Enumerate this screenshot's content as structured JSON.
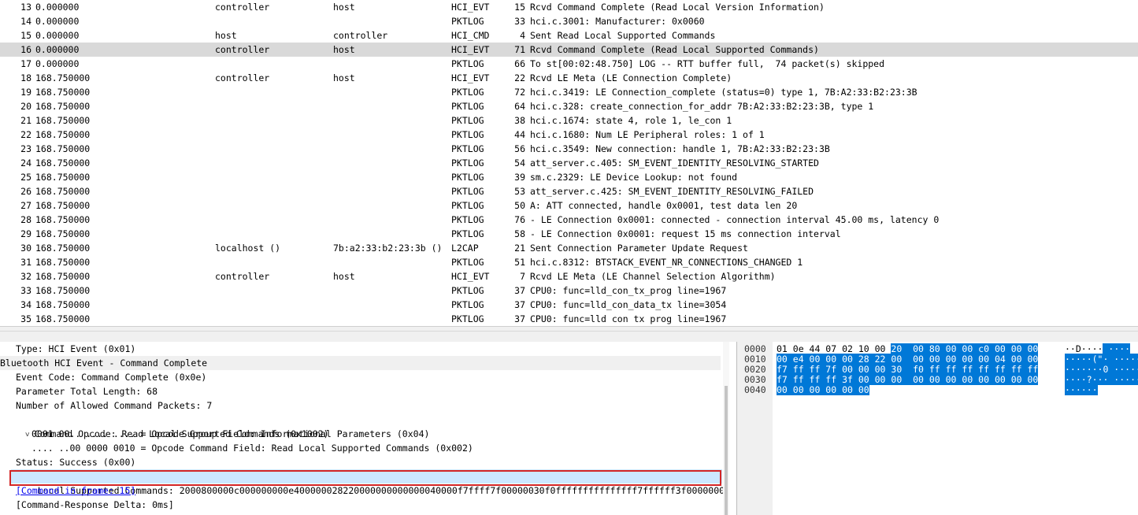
{
  "packets": [
    {
      "no": "13",
      "time": "0.000000",
      "src": "controller",
      "dst": "host",
      "proto": "HCI_EVT",
      "len": "15",
      "info": "Rcvd Command Complete (Read Local Version Information)"
    },
    {
      "no": "14",
      "time": "0.000000",
      "src": "",
      "dst": "",
      "proto": "PKTLOG",
      "len": "33",
      "info": "hci.c.3001: Manufacturer: 0x0060"
    },
    {
      "no": "15",
      "time": "0.000000",
      "src": "host",
      "dst": "controller",
      "proto": "HCI_CMD",
      "len": "4",
      "info": "Sent Read Local Supported Commands"
    },
    {
      "no": "16",
      "time": "0.000000",
      "src": "controller",
      "dst": "host",
      "proto": "HCI_EVT",
      "len": "71",
      "info": "Rcvd Command Complete (Read Local Supported Commands)"
    },
    {
      "no": "17",
      "time": "0.000000",
      "src": "",
      "dst": "",
      "proto": "PKTLOG",
      "len": "66",
      "info": "To st[00:02:48.750] LOG -- RTT buffer full,  74 packet(s) skipped"
    },
    {
      "no": "18",
      "time": "168.750000",
      "src": "controller",
      "dst": "host",
      "proto": "HCI_EVT",
      "len": "22",
      "info": "Rcvd LE Meta (LE Connection Complete)"
    },
    {
      "no": "19",
      "time": "168.750000",
      "src": "",
      "dst": "",
      "proto": "PKTLOG",
      "len": "72",
      "info": "hci.c.3419: LE Connection_complete (status=0) type 1, 7B:A2:33:B2:23:3B"
    },
    {
      "no": "20",
      "time": "168.750000",
      "src": "",
      "dst": "",
      "proto": "PKTLOG",
      "len": "64",
      "info": "hci.c.328: create_connection_for_addr 7B:A2:33:B2:23:3B, type 1"
    },
    {
      "no": "21",
      "time": "168.750000",
      "src": "",
      "dst": "",
      "proto": "PKTLOG",
      "len": "38",
      "info": "hci.c.1674: state 4, role 1, le_con 1"
    },
    {
      "no": "22",
      "time": "168.750000",
      "src": "",
      "dst": "",
      "proto": "PKTLOG",
      "len": "44",
      "info": "hci.c.1680: Num LE Peripheral roles: 1 of 1"
    },
    {
      "no": "23",
      "time": "168.750000",
      "src": "",
      "dst": "",
      "proto": "PKTLOG",
      "len": "56",
      "info": "hci.c.3549: New connection: handle 1, 7B:A2:33:B2:23:3B"
    },
    {
      "no": "24",
      "time": "168.750000",
      "src": "",
      "dst": "",
      "proto": "PKTLOG",
      "len": "54",
      "info": "att_server.c.405: SM_EVENT_IDENTITY_RESOLVING_STARTED"
    },
    {
      "no": "25",
      "time": "168.750000",
      "src": "",
      "dst": "",
      "proto": "PKTLOG",
      "len": "39",
      "info": "sm.c.2329: LE Device Lookup: not found"
    },
    {
      "no": "26",
      "time": "168.750000",
      "src": "",
      "dst": "",
      "proto": "PKTLOG",
      "len": "53",
      "info": "att_server.c.425: SM_EVENT_IDENTITY_RESOLVING_FAILED"
    },
    {
      "no": "27",
      "time": "168.750000",
      "src": "",
      "dst": "",
      "proto": "PKTLOG",
      "len": "50",
      "info": "A: ATT connected, handle 0x0001, test data len 20"
    },
    {
      "no": "28",
      "time": "168.750000",
      "src": "",
      "dst": "",
      "proto": "PKTLOG",
      "len": "76",
      "info": "- LE Connection 0x0001: connected - connection interval 45.00 ms, latency 0"
    },
    {
      "no": "29",
      "time": "168.750000",
      "src": "",
      "dst": "",
      "proto": "PKTLOG",
      "len": "58",
      "info": "- LE Connection 0x0001: request 15 ms connection interval"
    },
    {
      "no": "30",
      "time": "168.750000",
      "src": "localhost ()",
      "dst": "7b:a2:33:b2:23:3b ()",
      "proto": "L2CAP",
      "len": "21",
      "info": "Sent Connection Parameter Update Request"
    },
    {
      "no": "31",
      "time": "168.750000",
      "src": "",
      "dst": "",
      "proto": "PKTLOG",
      "len": "51",
      "info": "hci.c.8312: BTSTACK_EVENT_NR_CONNECTIONS_CHANGED 1"
    },
    {
      "no": "32",
      "time": "168.750000",
      "src": "controller",
      "dst": "host",
      "proto": "HCI_EVT",
      "len": "7",
      "info": "Rcvd LE Meta (LE Channel Selection Algorithm)"
    },
    {
      "no": "33",
      "time": "168.750000",
      "src": "",
      "dst": "",
      "proto": "PKTLOG",
      "len": "37",
      "info": "CPU0: func=lld_con_tx_prog line=1967"
    },
    {
      "no": "34",
      "time": "168.750000",
      "src": "",
      "dst": "",
      "proto": "PKTLOG",
      "len": "37",
      "info": "CPU0: func=lld_con_data_tx line=3054"
    },
    {
      "no": "35",
      "time": "168.750000",
      "src": "",
      "dst": "",
      "proto": "PKTLOG",
      "len": "37",
      "info": "CPU0: func=lld con tx prog line=1967"
    }
  ],
  "selected_packet": "16",
  "details": {
    "type": "Type: HCI Event (0x01)",
    "header": "Bluetooth HCI Event - Command Complete",
    "event_code": "Event Code: Command Complete (0x0e)",
    "param_len": "Parameter Total Length: 68",
    "allowed": "Number of Allowed Command Packets: 7",
    "caret": "˅",
    "opcode": "Command Opcode: Read Local Supported Commands (0x1002)",
    "ogf": "0001 00.. .... .... = Opcode Group Field: Informational Parameters (0x04)",
    "ocf": ".... ..00 0000 0010 = Opcode Command Field: Read Local Supported Commands (0x002)",
    "status": "Status: Success (0x00)",
    "local_commands": "Local Supported Commands: 2000800000c000000000e400000028220000000000000040000f7ffff7f00000030f0fffffffffffffff7ffffff3f0000000",
    "command_in_frame": "[Command in frame: 15]",
    "delta": "[Command-Response Delta: 0ms]"
  },
  "bytes": [
    {
      "offset": "0000",
      "hex_plain": "01 0e 44 07 02 10 00 ",
      "hex_sel": "20  00 80 00 00 c0 00 00 00",
      "ascii_plain": "··D····",
      "ascii_sel": " ····"
    },
    {
      "offset": "0010",
      "hex_plain": "",
      "hex_sel": "00 e4 00 00 00 28 22 00  00 00 00 00 00 04 00 00",
      "ascii_plain": "",
      "ascii_sel": "·····(\"· ······"
    },
    {
      "offset": "0020",
      "hex_plain": "",
      "hex_sel": "f7 ff ff 7f 00 00 00 30  f0 ff ff ff ff ff ff ff",
      "ascii_plain": "",
      "ascii_sel": "·······0 ········"
    },
    {
      "offset": "0030",
      "hex_plain": "",
      "hex_sel": "f7 ff ff ff 3f 00 00 00  00 00 00 00 00 00 00 00",
      "ascii_plain": "",
      "ascii_sel": "····?··· ········"
    },
    {
      "offset": "0040",
      "hex_plain": "",
      "hex_sel": "00 00 00 00 00 00",
      "ascii_plain": "",
      "ascii_sel": "······"
    }
  ],
  "colors": {
    "selected_row": "#d9d9d9",
    "field_highlight": "#cce8ff",
    "bytes_highlight": "#0078d7",
    "annotation_box": "#d32525"
  }
}
